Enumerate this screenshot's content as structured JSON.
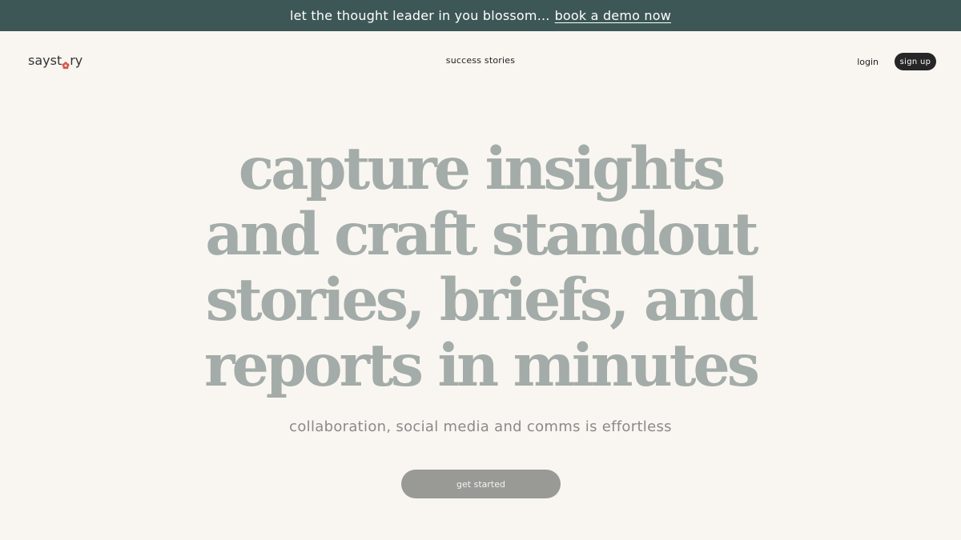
{
  "banner": {
    "text": "let the thought leader in you blossom...",
    "link_text": "book a demo now"
  },
  "header": {
    "logo_prefix": "sayst",
    "logo_icon": "flower-icon",
    "logo_suffix": "ry",
    "nav_center": "success stories",
    "login_label": "login",
    "signup_label": "sign up"
  },
  "hero": {
    "headline_lines": [
      "capture insights",
      "and craft standout",
      "stories, briefs, and",
      "reports in minutes"
    ],
    "subheadline": "collaboration, social media and comms is effortless",
    "cta_label": "get started"
  },
  "colors": {
    "banner_bg": "#3c5756",
    "page_bg": "#f9f6f1",
    "headline": "#a3aca9",
    "cta_bg": "#999996",
    "signup_bg": "#262626",
    "logo_accent": "#d9574a"
  }
}
